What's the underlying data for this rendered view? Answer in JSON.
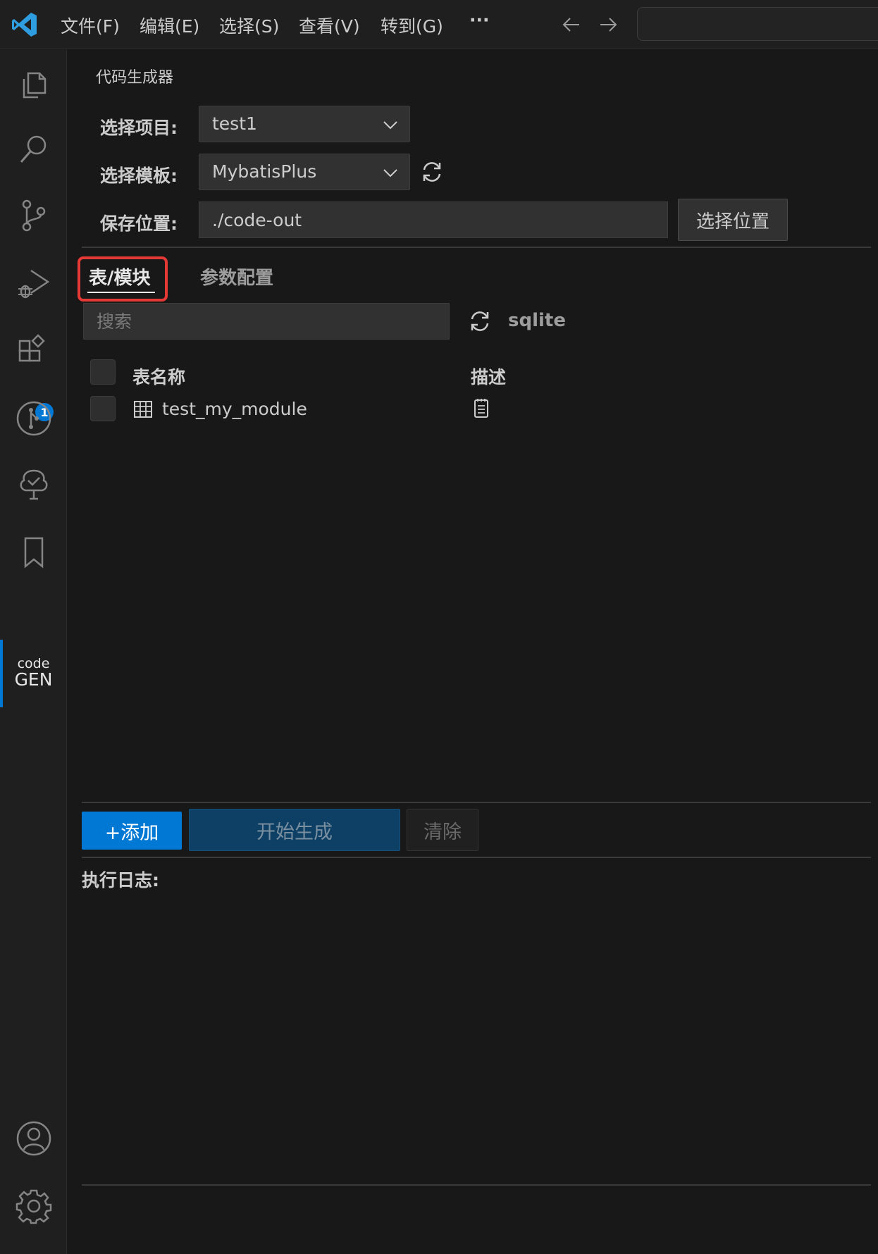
{
  "titlebar": {
    "menu": [
      "文件(F)",
      "编辑(E)",
      "选择(S)",
      "查看(V)",
      "转到(G)",
      "···"
    ]
  },
  "activity_bar": {
    "badge_count": "1",
    "codegen_top": "code",
    "codegen_bottom": "GEN"
  },
  "panel": {
    "title": "代码生成器",
    "project_label": "选择项目:",
    "project_value": "test1",
    "template_label": "选择模板:",
    "template_value": "MybatisPlus",
    "save_label": "保存位置:",
    "save_value": "./code-out",
    "choose_location_button": "选择位置",
    "tabs": [
      "表/模块",
      "参数配置"
    ],
    "search_placeholder": "搜索",
    "db_type": "sqlite",
    "columns": [
      "表名称",
      "描述"
    ],
    "rows": [
      {
        "name": "test_my_module"
      }
    ],
    "add_button": "+添加",
    "generate_button": "开始生成",
    "clear_button": "清除",
    "log_label": "执行日志:"
  },
  "colors": {
    "accent": "#0078d4",
    "highlight_border": "#e53935",
    "background": "#181818"
  }
}
